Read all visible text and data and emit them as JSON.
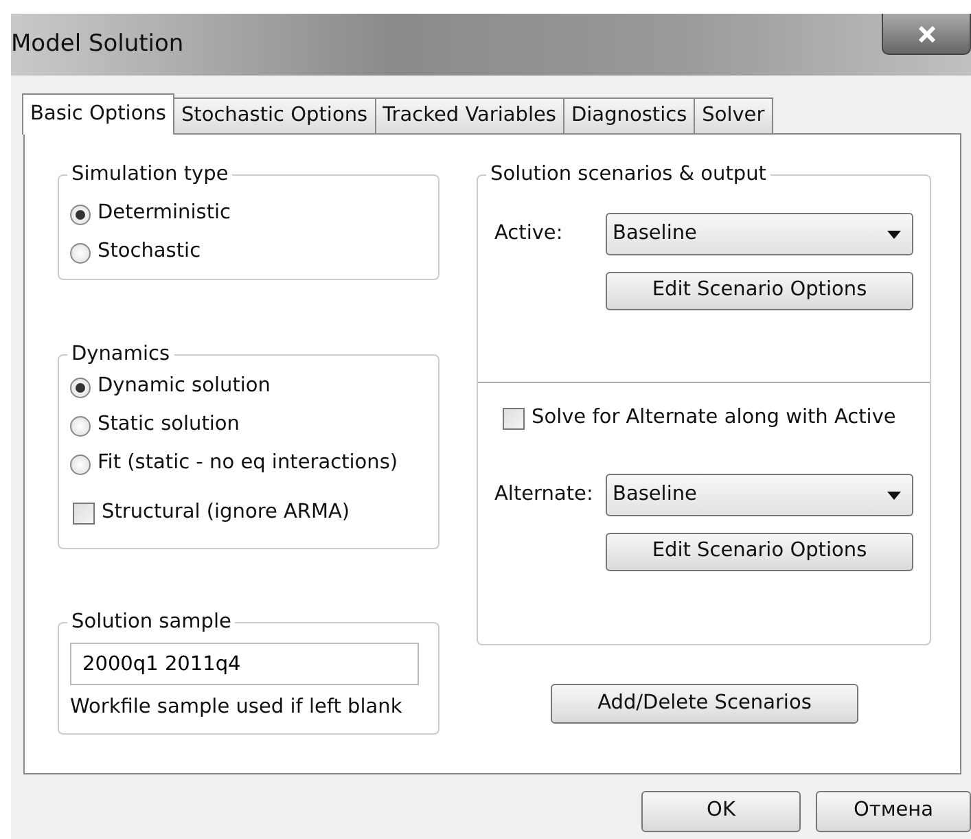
{
  "window": {
    "title": "Model Solution"
  },
  "tabs": [
    {
      "label": "Basic Options",
      "selected": true
    },
    {
      "label": "Stochastic Options",
      "selected": false
    },
    {
      "label": "Tracked Variables",
      "selected": false
    },
    {
      "label": "Diagnostics",
      "selected": false
    },
    {
      "label": "Solver",
      "selected": false
    }
  ],
  "simulation_type": {
    "label": "Simulation type",
    "options": [
      {
        "label": "Deterministic",
        "selected": true
      },
      {
        "label": "Stochastic",
        "selected": false
      }
    ]
  },
  "dynamics": {
    "label": "Dynamics",
    "options": [
      {
        "label": "Dynamic solution",
        "selected": true
      },
      {
        "label": "Static solution",
        "selected": false
      },
      {
        "label": "Fit (static - no eq interactions)",
        "selected": false
      }
    ],
    "structural": {
      "label": "Structural (ignore ARMA)",
      "checked": false
    }
  },
  "solution_sample": {
    "label": "Solution sample",
    "value": "2000q1 2011q4",
    "hint": "Workfile sample used if left blank"
  },
  "scenarios": {
    "label": "Solution scenarios & output",
    "active": {
      "label": "Active:",
      "value": "Baseline",
      "button": "Edit Scenario Options"
    },
    "solve_alternate": {
      "label": "Solve for Alternate along with Active",
      "checked": false
    },
    "alternate": {
      "label": "Alternate:",
      "value": "Baseline",
      "button": "Edit Scenario Options"
    }
  },
  "add_delete_button": "Add/Delete Scenarios",
  "buttons": [
    "OK",
    "Отмена"
  ]
}
